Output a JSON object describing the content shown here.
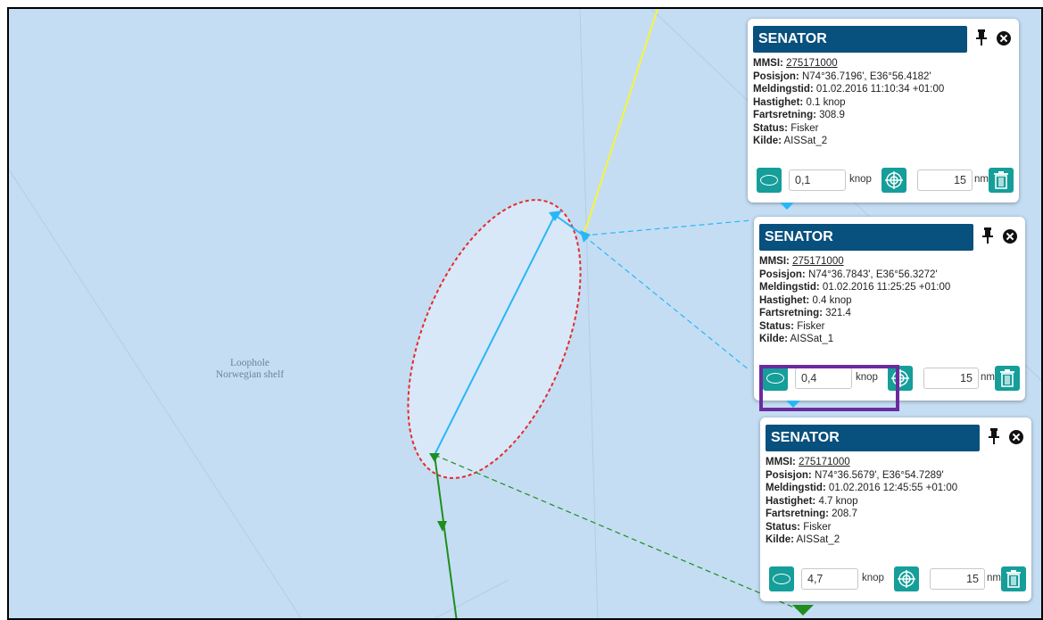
{
  "map": {
    "region_label_1": "Loophole",
    "region_label_2": "Norwegian shelf",
    "colors": {
      "water": "#c4ddf3",
      "ellipse_fill": "#d8e8f8",
      "ellipse_stroke": "#e52b2b",
      "track_blue": "#29b6f6",
      "track_yellow": "#f5f53a",
      "track_green": "#1e8e1e"
    }
  },
  "popups": [
    {
      "title": "SENATOR",
      "mmsi_label": "MMSI:",
      "mmsi": "275171000",
      "pos_label": "Posisjon:",
      "position": "N74°36.7196', E36°56.4182'",
      "time_label": "Meldingstid:",
      "time": "01.02.2016 11:10:34 +01:00",
      "speed_label": "Hastighet:",
      "speed": "0.1 knop",
      "course_label": "Fartsretning:",
      "course": "308.9",
      "status_label": "Status:",
      "status": "Fisker",
      "source_label": "Kilde:",
      "source": "AISSat_2",
      "speed_input": "0,1",
      "speed_unit": "knop",
      "dist_input": "15",
      "dist_unit": "nm"
    },
    {
      "title": "SENATOR",
      "mmsi_label": "MMSI:",
      "mmsi": "275171000",
      "pos_label": "Posisjon:",
      "position": "N74°36.7843', E36°56.3272'",
      "time_label": "Meldingstid:",
      "time": "01.02.2016 11:25:25 +01:00",
      "speed_label": "Hastighet:",
      "speed": "0.4 knop",
      "course_label": "Fartsretning:",
      "course": "321.4",
      "status_label": "Status:",
      "status": "Fisker",
      "source_label": "Kilde:",
      "source": "AISSat_1",
      "speed_input": "0,4",
      "speed_unit": "knop",
      "dist_input": "15",
      "dist_unit": "nm"
    },
    {
      "title": "SENATOR",
      "mmsi_label": "MMSI:",
      "mmsi": "275171000",
      "pos_label": "Posisjon:",
      "position": "N74°36.5679', E36°54.7289'",
      "time_label": "Meldingstid:",
      "time": "01.02.2016 12:45:55 +01:00",
      "speed_label": "Hastighet:",
      "speed": "4.7 knop",
      "course_label": "Fartsretning:",
      "course": "208.7",
      "status_label": "Status:",
      "status": "Fisker",
      "source_label": "Kilde:",
      "source": "AISSat_2",
      "speed_input": "4,7",
      "speed_unit": "knop",
      "dist_input": "15",
      "dist_unit": "nm"
    }
  ],
  "icons": {
    "pin": "pin-icon",
    "close": "close-icon",
    "ellipse": "ellipse-icon",
    "target": "crosshair-icon",
    "trash": "trash-icon"
  },
  "highlight_color": "#6b2b9f"
}
